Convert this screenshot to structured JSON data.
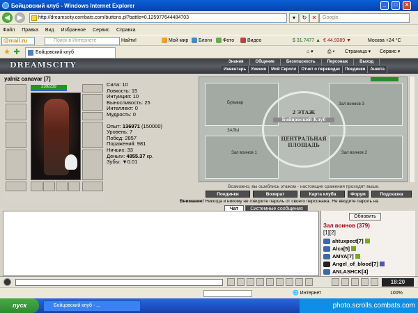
{
  "window": {
    "title": "Бойцовский клуб - Windows Internet Explorer",
    "url": "http://dreamscity.combats.com/buttons.pl?battle=0.125977644484703",
    "search_placeholder": "Google"
  },
  "menu": [
    "Файл",
    "Правка",
    "Вид",
    "Избранное",
    "Сервис",
    "Справка"
  ],
  "toolbar": {
    "mailru_label": "@mail.ru",
    "search_placeholder": "Поиск в Интернете",
    "find_label": "Найти!",
    "my_world": "Мой мир",
    "blogs": "Блоги",
    "photo": "Фото",
    "video": "Видео",
    "usd": "$ 31.7477 ▲",
    "eur": "€ 44.9389 ▼",
    "weather": "Москва +24 °C"
  },
  "tab": {
    "title": "Бойцовский клуб"
  },
  "right_tools": {
    "page": "Страница",
    "service": "Сервис"
  },
  "game": {
    "logo": "DREAMSCITY",
    "top_menu": [
      "Знания",
      "Общение",
      "Безопасность",
      "Персонаж",
      "Выход"
    ],
    "sub_menu": [
      "Инвентарь",
      "Умения",
      "Мой Скролл",
      "Отчет о переводах",
      "Поединки",
      "Анкета"
    ],
    "character": {
      "name": "yalniz canavar",
      "level": "[7]",
      "hp": "239/239",
      "stats": [
        "Сила: 10",
        "Ловкость: 15",
        "Интуиция: 10",
        "Выносливость: 25",
        "Интеллект: 0",
        "Мудрость: 0"
      ],
      "exp_label": "Опыт:",
      "exp_value": "136971",
      "exp_next": "(150000)",
      "level_line": "Уровень: 7",
      "wins": "Побед: 2857",
      "losses": "Поражений: 981",
      "draws": "Ничьих: 33",
      "money_label": "Деньги:",
      "money_value": "4855.37",
      "money_unit": "кр.",
      "teeth": "Зубы: ▼0.01"
    },
    "map": {
      "labels": {
        "boulevard": "Бульвар",
        "halls": "ЗАЛЫ",
        "hall3": "Зал воинов 3",
        "hall1": "Зал воинов 1",
        "hall2": "Зал воинов 2",
        "floor2": "2 ЭТАЖ",
        "club": "Бойцовский Клуб",
        "square": "ЦЕНТРАЛЬНАЯ ПЛОЩАДЬ"
      },
      "hint": "Возможно, вы ошиблись этажом - настоящие сражения проходят выше."
    },
    "buttons": [
      "Поединки",
      "Возврат",
      "Карта клуба",
      "Форум",
      "Подсказка"
    ],
    "warning_bold": "Внимание!",
    "warning_text": " Никогда и никому не говорите пароль от своего персонажа. Не вводите пароль на",
    "chat_tabs": {
      "chat": "Чат",
      "system": "Системные сообщения"
    },
    "warriors": {
      "refresh": "Обновить",
      "title": "Зал воинов (379)",
      "pages": "[1][2]",
      "list": [
        {
          "name": "ahtuxpect",
          "level": "[7]"
        },
        {
          "name": "Alca",
          "level": "[5]"
        },
        {
          "name": "AMYA",
          "level": "[7]"
        },
        {
          "name": "Angel_of_blood",
          "level": "[7]"
        },
        {
          "name": "ANLASHCK",
          "level": "[4]"
        }
      ]
    },
    "clock": "18:20"
  },
  "statusbar": {
    "zone": "Интернет",
    "zoom": "100%"
  },
  "taskbar": {
    "start": "пуск",
    "item": "Бойцовский клуб - ...",
    "watermark": "photo.scrolls.combats.com"
  },
  "colors": {
    "hp_bar": "#1a9a1a",
    "warriors_title": "#b0001a",
    "xp_titlebar": "#0a5fd8"
  }
}
